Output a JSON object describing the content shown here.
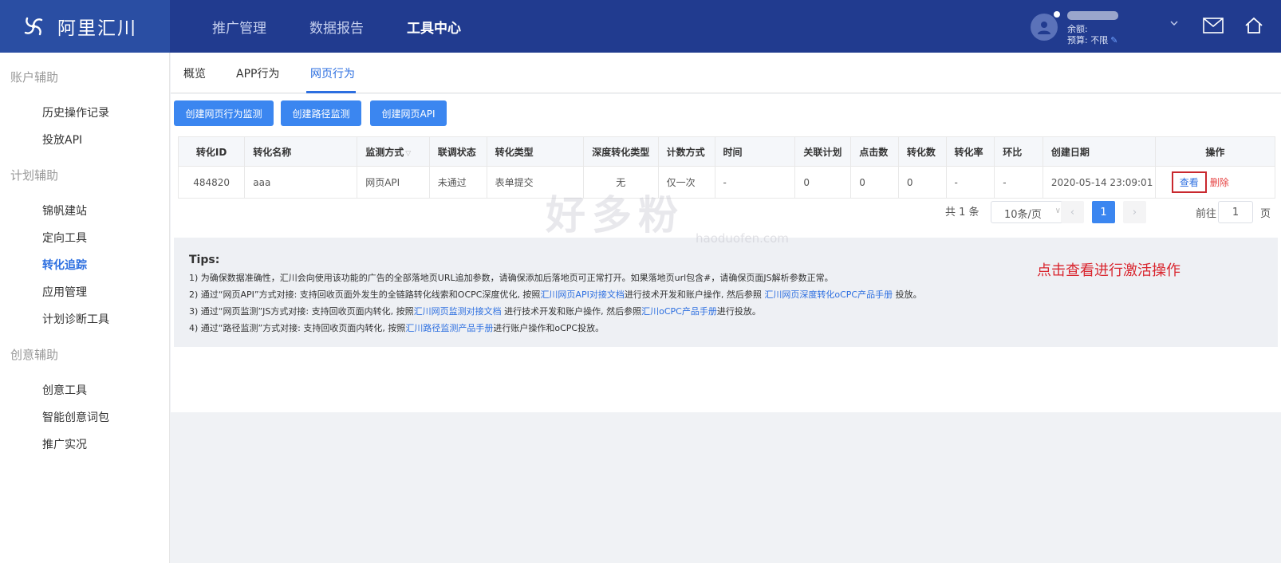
{
  "brand": {
    "name": "阿里汇川"
  },
  "topnav": [
    "推广管理",
    "数据报告",
    "工具中心"
  ],
  "user": {
    "balance_label": "余额:",
    "budget_label": "预算: 不限"
  },
  "sidebar": {
    "groups": [
      {
        "title": "账户辅助",
        "items": [
          "历史操作记录",
          "投放API"
        ]
      },
      {
        "title": "计划辅助",
        "items": [
          "锦帆建站",
          "定向工具",
          "转化追踪",
          "应用管理",
          "计划诊断工具"
        ]
      },
      {
        "title": "创意辅助",
        "items": [
          "创意工具",
          "智能创意词包",
          "推广实况"
        ]
      }
    ],
    "active": "转化追踪"
  },
  "tabs": [
    "概览",
    "APP行为",
    "网页行为"
  ],
  "buttons": [
    "创建网页行为监测",
    "创建路径监测",
    "创建网页API"
  ],
  "table": {
    "headers": [
      "转化ID",
      "转化名称",
      "监测方式",
      "联调状态",
      "转化类型",
      "深度转化类型",
      "计数方式",
      "时间",
      "关联计划",
      "点击数",
      "转化数",
      "转化率",
      "环比",
      "创建日期",
      "操作"
    ],
    "rows": [
      {
        "id": "484820",
        "name": "aaa",
        "method": "网页API",
        "status": "未通过",
        "type": "表单提交",
        "deep_type": "无",
        "count": "仅一次",
        "time": "-",
        "plans": "0",
        "clicks": "0",
        "conversions": "0",
        "rate": "-",
        "mom": "-",
        "created": "2020-05-14 23:09:01",
        "view": "查看",
        "delete": "删除"
      }
    ]
  },
  "pagination": {
    "total": "共 1 条",
    "page_size": "10条/页",
    "current": "1",
    "goto_label": "前往",
    "goto_value": "1",
    "goto_suffix": "页"
  },
  "tips": {
    "title": "Tips:",
    "line1": "1) 为确保数据准确性，汇川会向使用该功能的广告的全部落地页URL追加参数，请确保添加后落地页可正常打开。如果落地页url包含#，请确保页面JS解析参数正常。",
    "line2_a": "2) 通过“网页API”方式对接: 支持回收页面外发生的全链路转化线索和OCPC深度优化, 按照",
    "line2_link1": "汇川网页API对接文档",
    "line2_b": "进行技术开发和账户操作, 然后参照 ",
    "line2_link2": "汇川网页深度转化oCPC产品手册",
    "line2_c": " 投放。",
    "line3_a": "3) 通过“网页监测”JS方式对接: 支持回收页面内转化, 按照",
    "line3_link1": "汇川网页监测对接文档",
    "line3_b": " 进行技术开发和账户操作, 然后参照",
    "line3_link2": "汇川oCPC产品手册",
    "line3_c": "进行投放。",
    "line4_a": "4) 通过“路径监测”方式对接: 支持回收页面内转化, 按照",
    "line4_link1": "汇川路径监测产品手册",
    "line4_b": "进行账户操作和oCPC投放。"
  },
  "annotation": "点击查看进行激活操作",
  "watermark": {
    "text": "好多粉",
    "url": "haoduofen.com"
  },
  "colors": {
    "topbar": "#213b8f",
    "brand_bg": "#2a4ea3",
    "accent": "#3b86f0",
    "annotation": "#d9252e"
  }
}
